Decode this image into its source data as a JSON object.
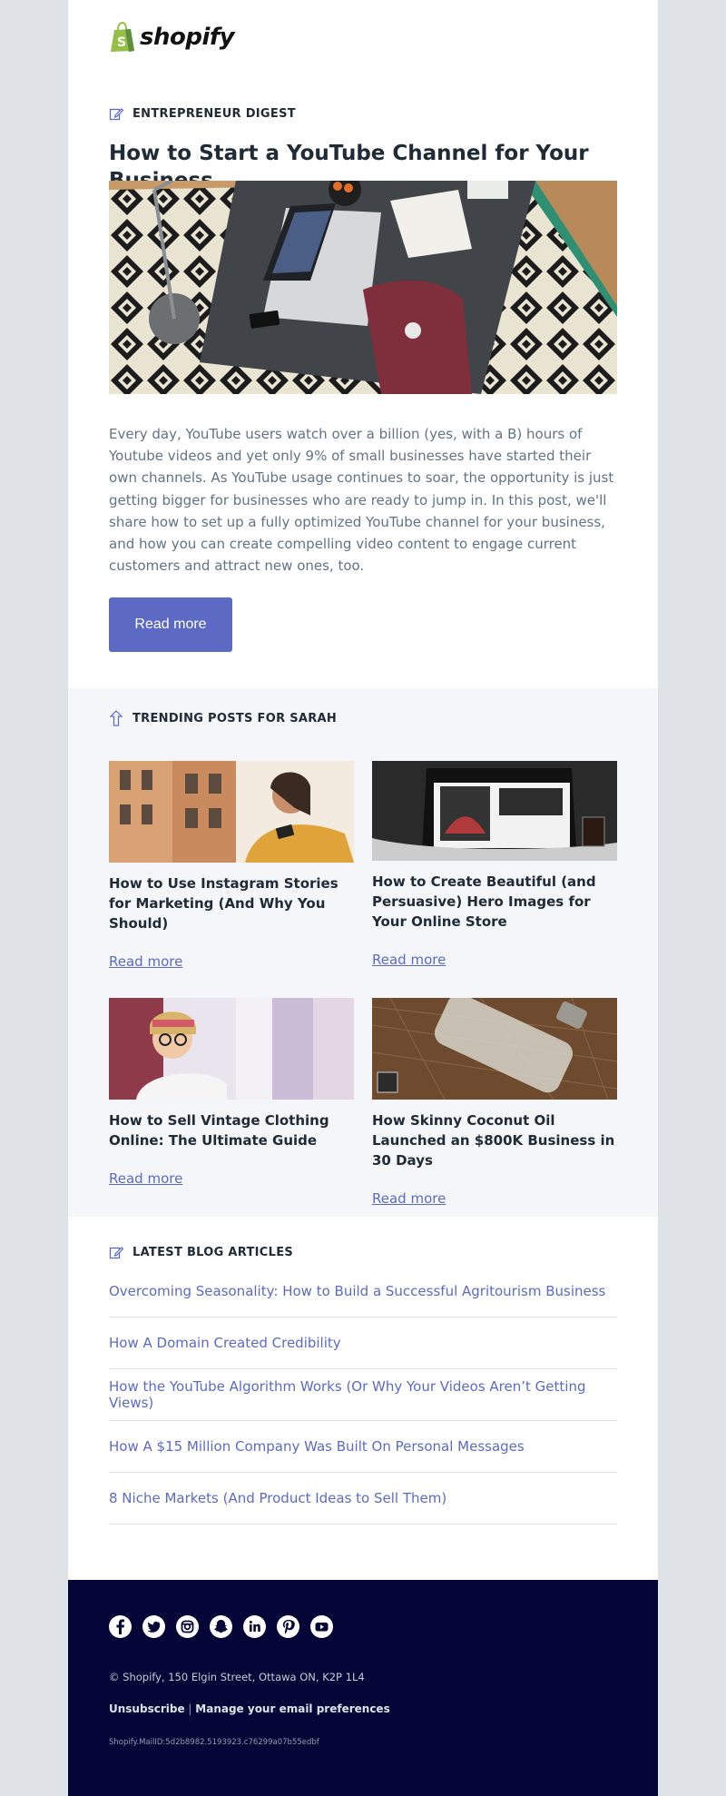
{
  "brand": {
    "name": "shopify",
    "accent": "#5c6ac4",
    "logo_green": "#95bf47"
  },
  "digest": {
    "label": "ENTREPRENEUR DIGEST",
    "title": "How to Start a YouTube Channel for Your Business",
    "body": "Every day, YouTube users watch over a billion (yes, with a B) hours of Youtube videos and yet only 9% of small businesses have started their own channels. As YouTube usage continues to soar, the opportunity is just getting bigger for businesses who are ready to jump in. In this post, we'll share how to set up a fully optimized YouTube channel for your business, and how you can create compelling video content to engage current customers and attract new ones, too.",
    "button": "Read more"
  },
  "trending": {
    "label": "TRENDING POSTS FOR SARAH",
    "cards": [
      {
        "title": "How to Use Instagram Stories for Marketing (And Why You Should)",
        "link": "Read more"
      },
      {
        "title": "How to Create Beautiful (and Persuasive) Hero Images for Your Online Store",
        "link": "Read more"
      },
      {
        "title": "How to Sell Vintage Clothing Online: The Ultimate Guide",
        "link": "Read more"
      },
      {
        "title": "How Skinny Coconut Oil Launched an $800K Business in 30 Days",
        "link": "Read more"
      }
    ]
  },
  "latest": {
    "label": "LATEST BLOG ARTICLES",
    "items": [
      "Overcoming Seasonality: How to Build a Successful Agritourism Business",
      "How A Domain Created Credibility",
      "How the YouTube Algorithm Works (Or Why Your Videos Aren’t Getting Views)",
      "How A $15 Million Company Was Built On Personal Messages",
      "8 Niche Markets (And Product Ideas to Sell Them)"
    ]
  },
  "footer": {
    "socials": [
      "facebook-icon",
      "twitter-icon",
      "instagram-icon",
      "snapchat-icon",
      "linkedin-icon",
      "pinterest-icon",
      "youtube-icon"
    ],
    "address": "© Shopify,  150 Elgin Street, Ottawa ON, K2P 1L4",
    "unsubscribe": "Unsubscribe",
    "separator": "|",
    "manage": "Manage your email preferences",
    "mail_id": "Shopify.MailID:5d2b8982.5193923.c76299a07b55edbf"
  }
}
